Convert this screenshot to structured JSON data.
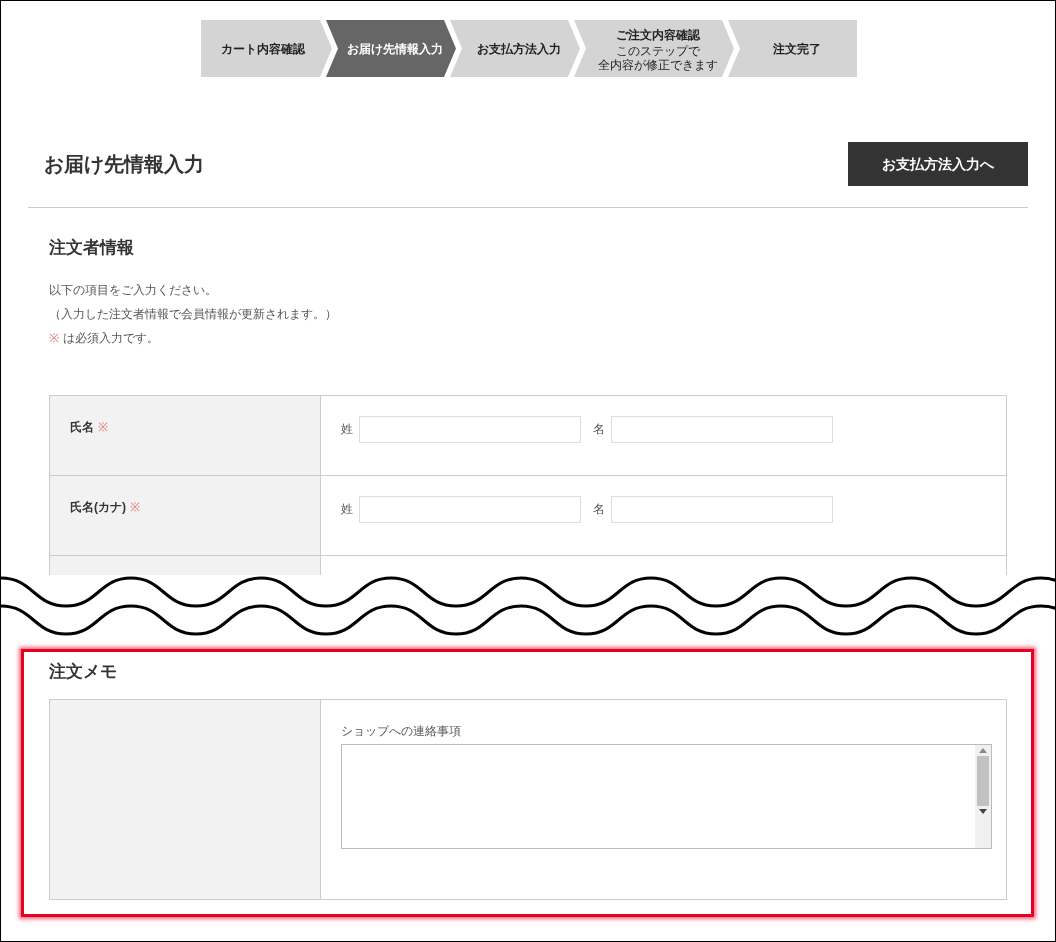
{
  "steps": [
    {
      "label": "カート内容確認",
      "selected": false
    },
    {
      "label": "お届け先情報入力",
      "selected": true
    },
    {
      "label": "お支払方法入力",
      "selected": false
    },
    {
      "label": "ご注文内容確認",
      "note": [
        "このステップで",
        "全内容が修正できます"
      ],
      "selected": false
    },
    {
      "label": "注文完了",
      "selected": false
    }
  ],
  "page_title": "お届け先情報入力",
  "next_button": "お支払方法入力へ",
  "orderer_section": {
    "title": "注文者情報",
    "intro": [
      "以下の項目をご入力ください。",
      "（入力した注文者情報で会員情報が更新されます。）"
    ],
    "required_note": {
      "mark": "※",
      "text": "は必須入力です。"
    },
    "rows": [
      {
        "label": "氏名",
        "required": true,
        "required_mark": "※",
        "fields": [
          {
            "label": "姓"
          },
          {
            "label": "名"
          }
        ]
      },
      {
        "label": "氏名(カナ)",
        "required": true,
        "required_mark": "※",
        "fields": [
          {
            "label": "姓"
          },
          {
            "label": "名"
          }
        ]
      }
    ]
  },
  "memo_section": {
    "title": "注文メモ",
    "field_label": "ショップへの連絡事項",
    "highlighted": true
  }
}
